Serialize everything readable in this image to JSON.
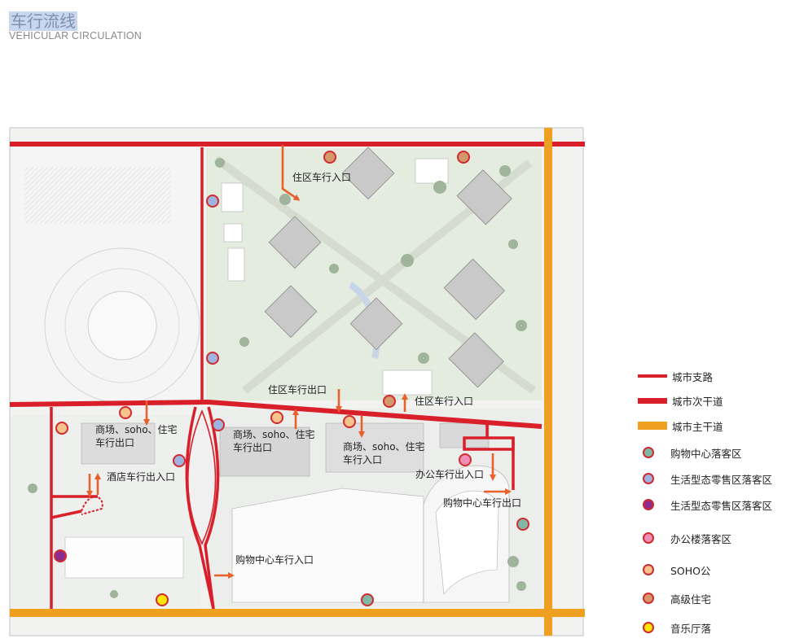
{
  "header": {
    "title_cn": "车行流线",
    "title_en": "VEHICULAR CIRCULATION"
  },
  "colors": {
    "branch_road": "#d81f2a",
    "secondary_road": "#d81f2a",
    "main_road": "#f0a020",
    "arrow": "#e8612c",
    "dot_border": "#d22a2f",
    "dot_green": "#7fb8a6",
    "dot_blue": "#9fb3e0",
    "dot_purple": "#8b2d8c",
    "dot_pink": "#ee8fb8",
    "dot_peach": "#f6c38c",
    "dot_tan": "#d4996a",
    "dot_yellow": "#ffe600"
  },
  "map_labels": {
    "res_entry_top": "住区车行入口",
    "res_exit": "住区车行出口",
    "res_entry_mid": "住区车行入口",
    "mixed_exit_1a": "商场、soho、住宅",
    "mixed_exit_1b": "车行出口",
    "mixed_exit_2a": "商场、soho、住宅",
    "mixed_exit_2b": "车行出口",
    "mixed_entry_3a": "商场、soho、住宅",
    "mixed_entry_3b": "车行入口",
    "hotel_exit": "酒店车行出入口",
    "office_exit": "办公车行出入口",
    "mall_exit": "购物中心车行出口",
    "mall_entry": "购物中心车行入口"
  },
  "legend": [
    {
      "type": "line",
      "label": "城市支路",
      "color": "#d81f2a",
      "thickness": 4
    },
    {
      "type": "line",
      "label": "城市次干道",
      "color": "#d81f2a",
      "thickness": 7
    },
    {
      "type": "line",
      "label": "城市主干道",
      "color": "#f0a020",
      "thickness": 10
    },
    {
      "type": "dot",
      "label": "购物中心落客区",
      "fill": "#7fb8a6"
    },
    {
      "type": "dot",
      "label": "生活型态零售区落客区",
      "fill": "#9fb3e0"
    },
    {
      "type": "dot",
      "label": "生活型态零售区落客区",
      "fill": "#8b2d8c"
    },
    {
      "type": "dot",
      "label": "办公楼落客区",
      "fill": "#ee8fb8"
    },
    {
      "type": "dot",
      "label": "SOHO公",
      "fill": "#f6c38c"
    },
    {
      "type": "dot",
      "label": "高级住宅",
      "fill": "#d4996a"
    },
    {
      "type": "dot",
      "label": "音乐厅落",
      "fill": "#ffe600"
    }
  ]
}
